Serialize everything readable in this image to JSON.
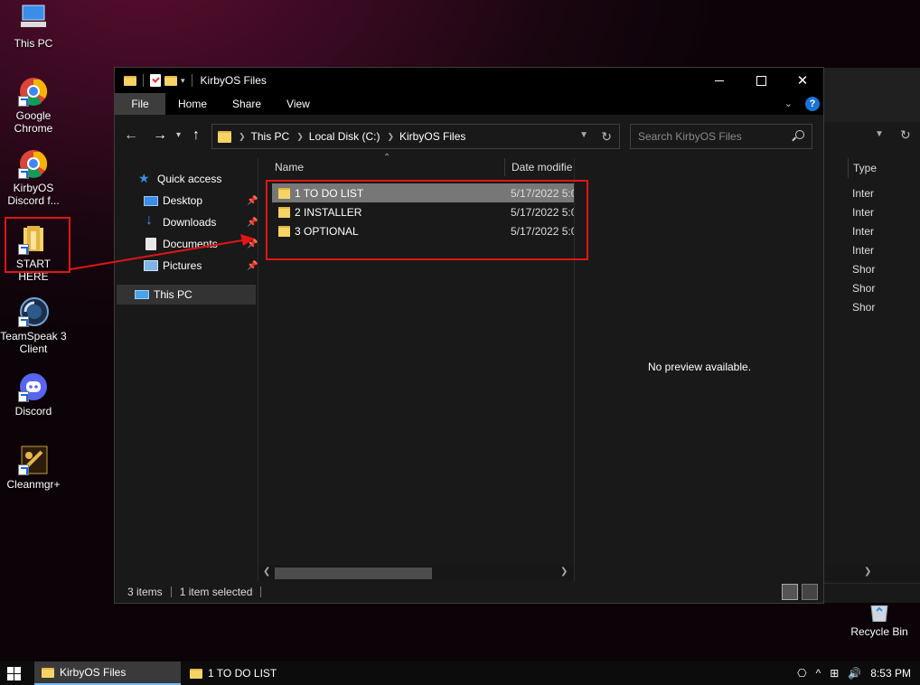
{
  "desktop": {
    "icons": [
      {
        "label": "This PC"
      },
      {
        "label": "Google Chrome"
      },
      {
        "label": "KirbyOS Discord f..."
      },
      {
        "label": "START HERE"
      },
      {
        "label": "TeamSpeak 3 Client"
      },
      {
        "label": "Discord"
      },
      {
        "label": "Cleanmgr+"
      }
    ],
    "recycle_bin": "Recycle Bin"
  },
  "background_window": {
    "column_header": "Type",
    "types": [
      "Inter",
      "Inter",
      "Inter",
      "Inter",
      "Shor",
      "Shor",
      "Shor"
    ]
  },
  "window": {
    "title": "KirbyOS Files",
    "controls": {
      "close": "✕"
    },
    "ribbon_tabs": [
      "File",
      "Home",
      "Share",
      "View"
    ],
    "help": "?",
    "address": {
      "crumbs": [
        "This PC",
        "Local Disk (C:)",
        "KirbyOS Files"
      ]
    },
    "search": {
      "placeholder": "Search KirbyOS Files"
    },
    "nav": {
      "quick_access": "Quick access",
      "items": [
        {
          "label": "Desktop",
          "icon": "desktop-icon",
          "pinned": true
        },
        {
          "label": "Downloads",
          "icon": "download-icon",
          "pinned": true
        },
        {
          "label": "Documents",
          "icon": "document-icon",
          "pinned": true
        },
        {
          "label": "Pictures",
          "icon": "picture-icon",
          "pinned": true
        }
      ],
      "this_pc": "This PC"
    },
    "columns": {
      "name": "Name",
      "date": "Date modifie"
    },
    "files": [
      {
        "name": "1 TO DO LIST",
        "date": "5/17/2022 5:0",
        "selected": true
      },
      {
        "name": "2 INSTALLER",
        "date": "5/17/2022 5:0",
        "selected": false
      },
      {
        "name": "3 OPTIONAL",
        "date": "5/17/2022 5:0",
        "selected": false
      }
    ],
    "preview_text": "No preview available.",
    "status": {
      "items": "3 items",
      "selected": "1 item selected"
    }
  },
  "taskbar": {
    "items": [
      {
        "label": "KirbyOS Files",
        "active": true
      },
      {
        "label": "1 TO DO LIST",
        "active": false
      }
    ],
    "clock": "8:53 PM"
  },
  "colors": {
    "annotation": "#e01515",
    "accent": "#1a73d6",
    "folder": "#f6d365"
  }
}
